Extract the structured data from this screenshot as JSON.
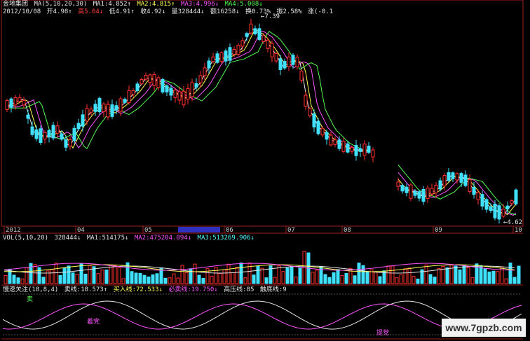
{
  "header": {
    "title": "金地集团",
    "ma_label": "MA(5,10,20,30)",
    "ma1": "MA1:4.852↑",
    "ma2": "MA2:4.815↑",
    "ma3": "MA3:4.996↓",
    "ma4": "MA4:5.008↓",
    "date": "2012/10/08",
    "open": "开4.98↑",
    "high": "高5.04↓",
    "low": "低4.91↑",
    "close": "收4.92↓",
    "volume": "量328444↓",
    "amount": "额16258↓",
    "turnover": "换0.73%",
    "amplitude": "振2.58%",
    "change": "涨(-0.1"
  },
  "vol_header": {
    "label": "VOL(5,10,20)",
    "value": "328444↓",
    "ma1": "MA1:514175↓",
    "ma2": "MA2:475204.094↓",
    "ma3": "MA3:513269.906↓"
  },
  "ind_header": {
    "label": "慢速关注(18,8,4)",
    "sell": "卖线:18.573↑",
    "buy": "买入线:72.533↓",
    "must_sell": "必卖线:19.750↓",
    "high_press": "高压线:85",
    "bottom": "触底线:9"
  },
  "chart_data": {
    "type": "candlestick",
    "price_axis": {
      "ylim": [
        4.5,
        7.5
      ]
    },
    "annotations": {
      "high_label": "7.39",
      "low_label": "4.62"
    },
    "x_tick_labels": [
      "2012",
      "04",
      "05",
      "06",
      "07",
      "08",
      "09",
      "10"
    ],
    "volume_note": "volume bars shown; legend values in vol_header",
    "indicator_labels": [
      "卖",
      "着党",
      "提党"
    ]
  },
  "watermark": "www.7gpzb.com"
}
